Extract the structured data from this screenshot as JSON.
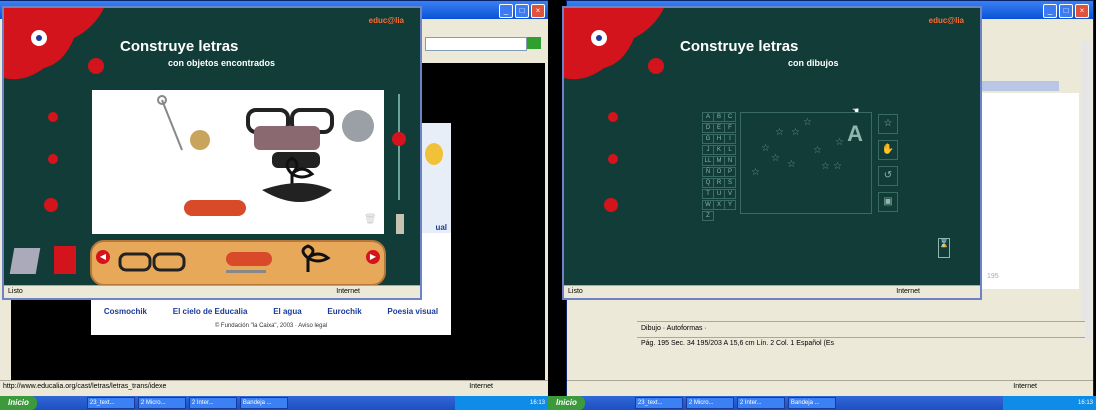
{
  "left": {
    "game": {
      "logo": "educ@lia",
      "title": "Construye letras",
      "subtitle": "con objetos encontrados",
      "status": "Listo",
      "internet": "Internet"
    },
    "site": {
      "nav": [
        "Cosmochik",
        "El cielo de Educalia",
        "El agua",
        "Eurochik",
        "Poesia visual"
      ],
      "footer": "© Fundación \"la Caixa\", 2003 · Aviso legal",
      "side_text": "ual"
    },
    "browser_status": "http://www.educalia.org/cast/letras/letras_trans/idexe",
    "browser_internet": "Internet",
    "taskbar": {
      "start": "Inicio",
      "tasks": [
        "23_text...",
        "2 Micro...",
        "2 Inter...",
        "Bandeja ..."
      ],
      "clock": "16:13"
    }
  },
  "right": {
    "game": {
      "logo": "educ@lia",
      "title": "Construye letras",
      "subtitle": "con dibujos",
      "status": "Listo",
      "internet": "Internet",
      "big_letter": "A",
      "letters": [
        "A",
        "B",
        "C",
        "D",
        "E",
        "F",
        "G",
        "H",
        "I",
        "J",
        "K",
        "L",
        "LL",
        "M",
        "N",
        "Ñ",
        "O",
        "P",
        "Q",
        "R",
        "S",
        "T",
        "U",
        "V",
        "W",
        "X",
        "Y",
        "Z"
      ]
    },
    "word": {
      "draw_toolbar": "Dibujo · Autoformas ·",
      "statusbar": "Pág. 195   Sec. 34   195/203   A 15,6 cm  Lín. 2   Col. 1        Español (Es",
      "page_num": "195"
    },
    "browser_internet": "Internet",
    "taskbar": {
      "start": "Inicio",
      "tasks": [
        "23_text...",
        "2 Micro...",
        "2 Inter...",
        "Bandeja ..."
      ],
      "clock": "16:13"
    }
  },
  "colors": {
    "game_bg": "#123c38",
    "splat": "#d3141c",
    "taskbar": "#245edb"
  }
}
